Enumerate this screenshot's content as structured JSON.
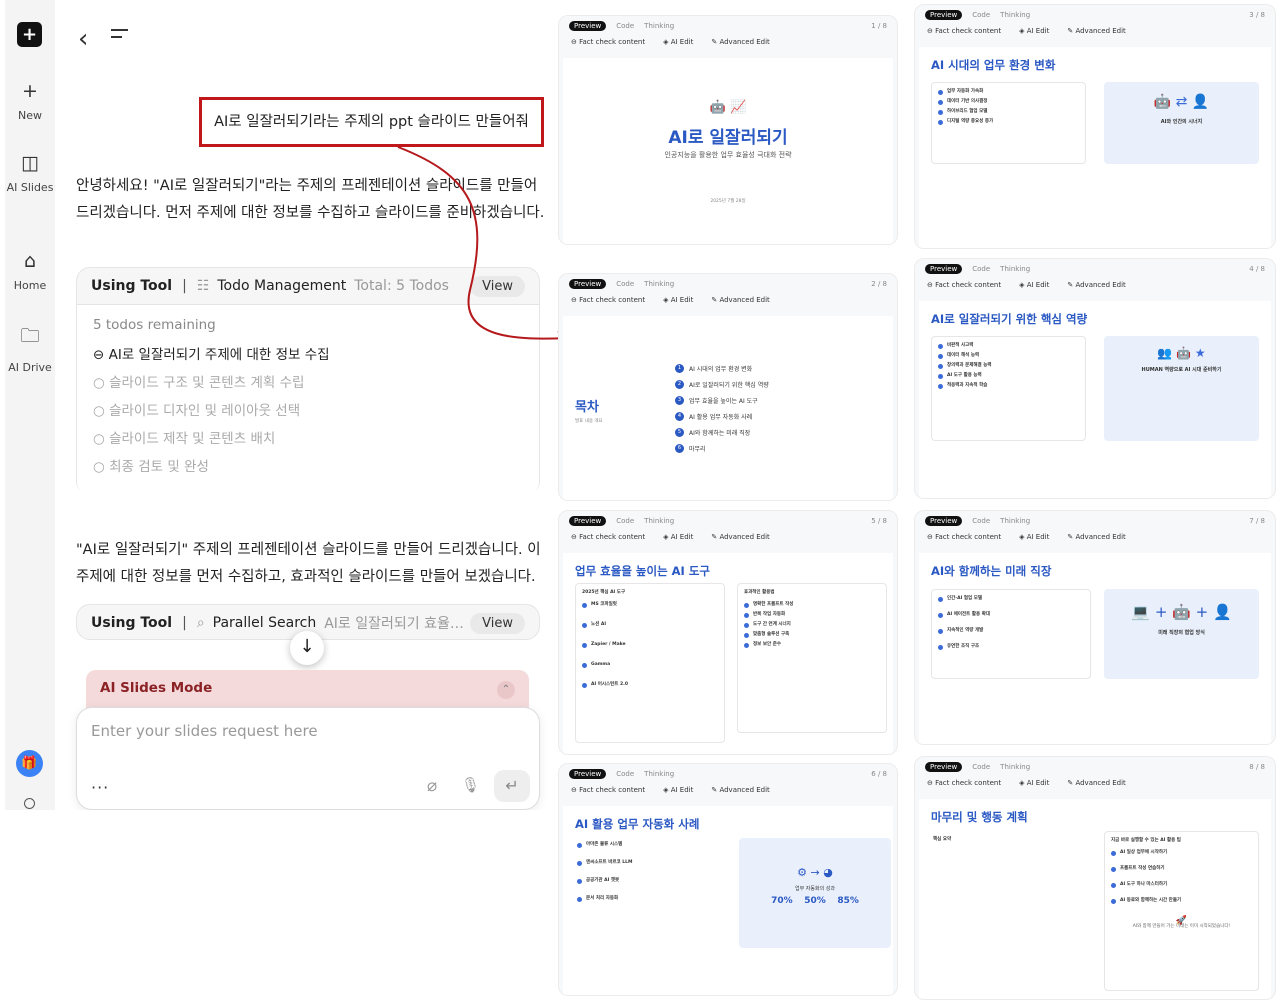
{
  "rail": {
    "logo": "+",
    "new_label": "New",
    "slides_label": "AI Slides",
    "home_label": "Home",
    "drive_label": "AI Drive"
  },
  "chat": {
    "user_message": "AI로 일잘러되기라는 주제의 ppt 슬라이드 만들어줘",
    "reply1": "안녕하세요! \"AI로 일잘러되기\"라는 주제의 프레젠테이션 슬라이드를 만들어 드리겠습니다. 먼저 주제에 대한 정보를 수집하고 슬라이드를 준비하겠습니다.",
    "tool1": {
      "using": "Using Tool",
      "sep": "|",
      "name": "Todo Management",
      "total": "Total: 5 Todos",
      "view": "View",
      "remaining": "5 todos remaining",
      "todos": [
        {
          "text": "AI로 일잘러되기 주제에 대한 정보 수집",
          "icon": "⊖"
        },
        {
          "text": "슬라이드 구조 및 콘텐츠 계획 수립",
          "icon": "○"
        },
        {
          "text": "슬라이드 디자인 및 레이아웃 선택",
          "icon": "○"
        },
        {
          "text": "슬라이드 제작 및 콘텐츠 배치",
          "icon": "○"
        },
        {
          "text": "최종 검토 및 완성",
          "icon": "○"
        }
      ]
    },
    "reply2": "\"AI로 일잘러되기\" 주제의 프레젠테이션 슬라이드를 만들어 드리겠습니다. 이 주제에 대한 정보를 먼저 수집하고, 효과적인 슬라이드를 만들어 보겠습니다.",
    "tool2": {
      "using": "Using Tool",
      "sep": "|",
      "name": "Parallel Search",
      "query": "AI로 일잘러되기 효율성 향상 AI",
      "view": "View"
    },
    "mode_label": "AI Slides Mode",
    "input_placeholder": "Enter your slides request here",
    "more": "···"
  },
  "card_ui": {
    "tabs": [
      "Preview",
      "Code",
      "Thinking"
    ],
    "actions": [
      "⊖ Fact check content",
      "◈ AI Edit",
      "✎ Advanced Edit"
    ]
  },
  "slides": {
    "s1": {
      "num": "1 / 8",
      "icons": "🤖 📈",
      "title": "AI로 일잘러되기",
      "subtitle": "인공지능을 활용한 업무 효율성 극대화 전략",
      "date": "2025년 7월 28일"
    },
    "s2": {
      "num": "2 / 8",
      "title": "목차",
      "subtitle": "발표 내용 개요",
      "items": [
        {
          "n": "1",
          "t": "AI 시대의 업무 환경 변화"
        },
        {
          "n": "2",
          "t": "AI로 일잘러되기 위한 핵심 역량"
        },
        {
          "n": "3",
          "t": "업무 효율을 높이는 AI 도구"
        },
        {
          "n": "4",
          "t": "AI 활용 업무 자동화 사례"
        },
        {
          "n": "5",
          "t": "AI와 함께하는 미래 직장"
        },
        {
          "n": "6",
          "t": "마무리"
        }
      ]
    },
    "s3": {
      "num": "3 / 8",
      "title": "AI 시대의 업무 환경 변화",
      "items": [
        "업무 자동화 가속화",
        "데이터 기반 의사결정",
        "하이브리드 협업 모델",
        "디지털 역량 중요성 증가"
      ],
      "box_title": "AI와 인간의 시너지"
    },
    "s4": {
      "num": "4 / 8",
      "title": "AI로 일잘러되기 위한 핵심 역량",
      "items": [
        "비판적 사고력",
        "데이터 해석 능력",
        "창의력과 문제해결 능력",
        "AI 도구 활용 능력",
        "적응력과 지속적 학습"
      ],
      "box_title": "HUMAN 역량으로 AI 시대 준비하기"
    },
    "s5": {
      "num": "5 / 8",
      "title": "업무 효율을 높이는 AI 도구",
      "left_head": "2025년 핵심 AI 도구",
      "tools": [
        "MS 코파일럿",
        "노션 AI",
        "Zapier / Make",
        "Gamma",
        "AI 어시스턴트 2.0"
      ],
      "right_head": "효과적인 활용법",
      "uses": [
        "명확한 프롬프트 작성",
        "반복 작업 자동화",
        "도구 간 연계 시너지",
        "맞춤형 솔루션 구축",
        "정보 보안 준수"
      ]
    },
    "s6": {
      "num": "6 / 8",
      "title": "AI 활용 업무 자동화 사례",
      "items": [
        "아마존 물류 시스템",
        "엔씨소프트 바르코 LLM",
        "공공기관 AI 챗봇",
        "문서 처리 자동화"
      ],
      "box_title": "업무 자동화의 성과",
      "stats": [
        "70%",
        "50%",
        "85%"
      ]
    },
    "s7": {
      "num": "7 / 8",
      "title": "AI와 함께하는 미래 직장",
      "items": [
        "인간-AI 협업 모델",
        "AI 에이전트 활용 확대",
        "지속적인 역량 개발",
        "유연한 조직 구조"
      ],
      "box_title": "미래 직장의 협업 방식"
    },
    "s8": {
      "num": "8 / 8",
      "title": "마무리 및 행동 계획",
      "left_head": "핵심 요약",
      "right_head": "지금 바로 실행할 수 있는 AI 활용 팁",
      "tips": [
        "AI 일상 업무에 시작하기",
        "프롬프트 작성 연습하기",
        "AI 도구 하나 마스터하기",
        "AI 동료와 함께하는 시간 만들기"
      ],
      "footer": "AI와 함께 만들어 가는 미래는 이미 시작되었습니다!"
    }
  },
  "colors": {
    "accent": "#2b59c3",
    "highlight_border": "#c0181a",
    "mode_bar": "#f4dadb"
  }
}
